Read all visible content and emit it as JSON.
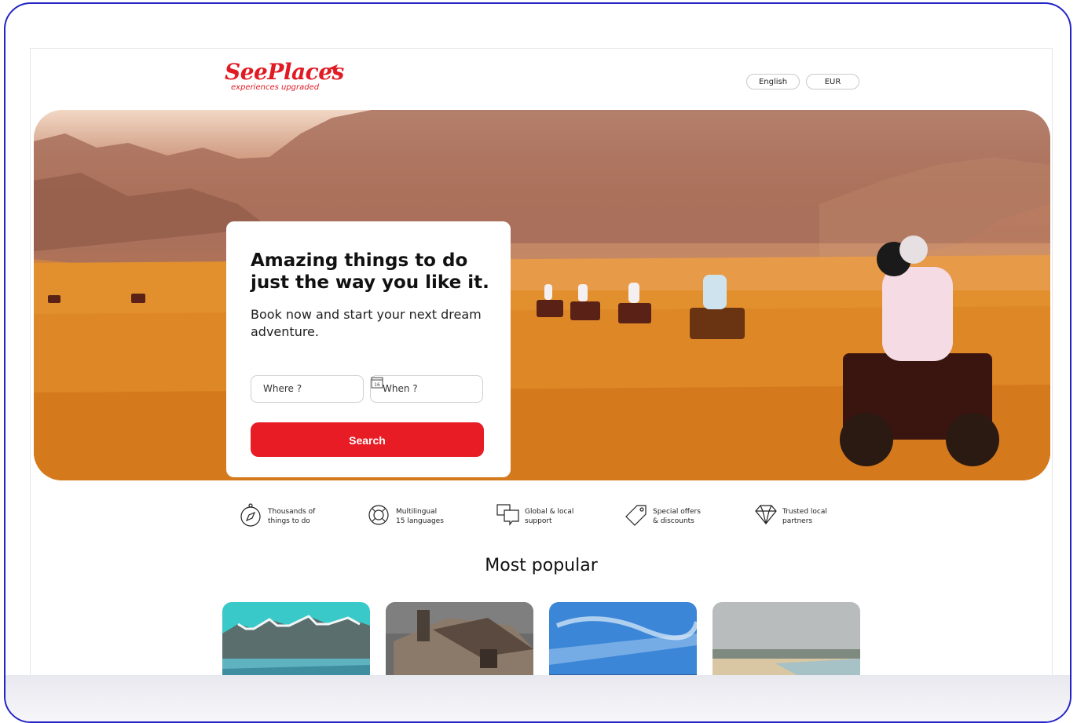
{
  "header": {
    "logo_text": "SeePlaces",
    "logo_tagline": "experiences upgraded",
    "language": "English",
    "currency": "EUR"
  },
  "hero": {
    "title": "Amazing things to do just the way you like it.",
    "subtitle": "Book now and start your next dream adventure.",
    "where_placeholder": "Where ?",
    "when_placeholder": "When ?",
    "calendar_day": "16",
    "search_label": "Search"
  },
  "features": [
    {
      "icon": "compass-icon",
      "text": "Thousands of\nthings to do"
    },
    {
      "icon": "lifebuoy-icon",
      "text": "Multilingual\n15 languages"
    },
    {
      "icon": "chat-bubbles-icon",
      "text": "Global & local\nsupport"
    },
    {
      "icon": "tag-icon",
      "text": "Special offers\n& discounts"
    },
    {
      "icon": "diamond-icon",
      "text": "Trusted local\npartners"
    }
  ],
  "popular": {
    "title": "Most popular",
    "items": [
      {
        "scene": "mountain-lake"
      },
      {
        "scene": "wooden-cabin"
      },
      {
        "scene": "blue-sky-sea"
      },
      {
        "scene": "beach-town"
      }
    ]
  },
  "colors": {
    "brand": "#e01b24",
    "button": "#e81c24",
    "frame_border": "#2323c8"
  }
}
